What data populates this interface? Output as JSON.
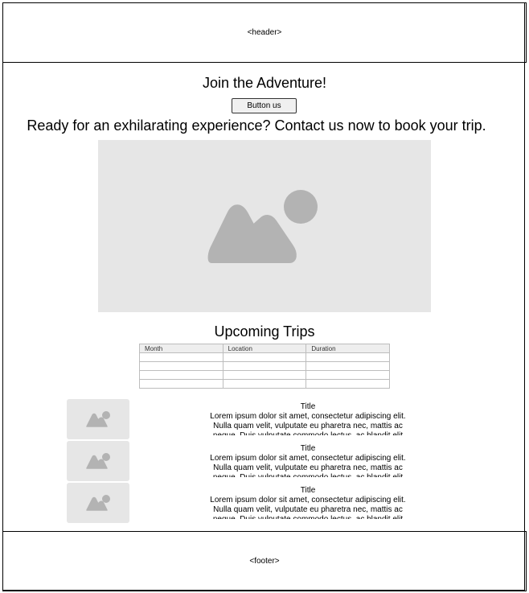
{
  "header": {
    "label": "<header>"
  },
  "hero": {
    "title": "Join the Adventure!",
    "button_label": "Button us",
    "tagline": "Ready for an exhilarating experience? Contact us now to book your trip.",
    "image_icon": "image-placeholder-icon"
  },
  "trips": {
    "title": "Upcoming Trips",
    "columns": [
      "Month",
      "Location",
      "Duration"
    ],
    "rows": [
      [
        "",
        "",
        ""
      ],
      [
        "",
        "",
        ""
      ],
      [
        "",
        "",
        ""
      ],
      [
        "",
        "",
        ""
      ]
    ]
  },
  "cards": [
    {
      "title": "Title",
      "body": "Lorem ipsum dolor sit amet, consectetur adipiscing elit. Nulla quam velit, vulputate eu pharetra nec, mattis ac neque. Duis vulputate commodo lectus, ac blandit elit tincidunt id. Sed"
    },
    {
      "title": "Title",
      "body": "Lorem ipsum dolor sit amet, consectetur adipiscing elit. Nulla quam velit, vulputate eu pharetra nec, mattis ac neque. Duis vulputate commodo lectus, ac blandit elit tincidunt id. Sed"
    },
    {
      "title": "Title",
      "body": "Lorem ipsum dolor sit amet, consectetur adipiscing elit. Nulla quam velit, vulputate eu pharetra nec, mattis ac neque. Duis vulputate commodo lectus, ac blandit elit tincidunt id. Sed"
    }
  ],
  "footer": {
    "label": "<footer>"
  },
  "colors": {
    "placeholder_bg": "#e6e6e6",
    "placeholder_shape": "#b3b3b3",
    "border": "#000000"
  }
}
